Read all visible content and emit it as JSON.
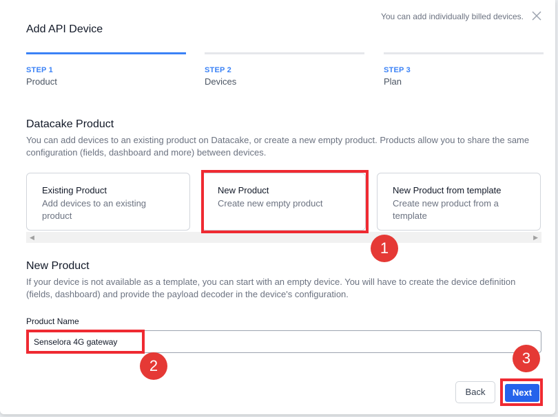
{
  "dialog": {
    "title": "Add API Device",
    "note": "You can add individually billed devices."
  },
  "steps": [
    {
      "number": "STEP 1",
      "name": "Product",
      "active": true
    },
    {
      "number": "STEP 2",
      "name": "Devices",
      "active": false
    },
    {
      "number": "STEP 3",
      "name": "Plan",
      "active": false
    }
  ],
  "product_section": {
    "heading": "Datacake Product",
    "description": "You can add devices to an existing product on Datacake, or create a new empty product. Products allow you to share the same configuration (fields, dashboard and more) between devices.",
    "options": [
      {
        "title": "Existing Product",
        "description": "Add devices to an existing product"
      },
      {
        "title": "New Product",
        "description": "Create new empty product"
      },
      {
        "title": "New Product from template",
        "description": "Create new product from a template"
      }
    ],
    "selected_option": "New Product"
  },
  "new_product_section": {
    "heading": "New Product",
    "description": "If your device is not available as a template, you can start with an empty device. You will have to create the device definition (fields, dashboard) and provide the payload decoder in the device's configuration.",
    "field_label": "Product Name",
    "field_value": "Senselora 4G gateway"
  },
  "buttons": {
    "back": "Back",
    "next": "Next"
  },
  "annotations": [
    "1",
    "2",
    "3"
  ],
  "colors": {
    "accent": "#3b82f6",
    "primary_button": "#2563eb",
    "highlight": "#ef2a32",
    "badge": "#e53935"
  },
  "icons": {
    "close": "close-icon",
    "scroll_left": "chevron-left-icon",
    "scroll_right": "chevron-right-icon"
  }
}
